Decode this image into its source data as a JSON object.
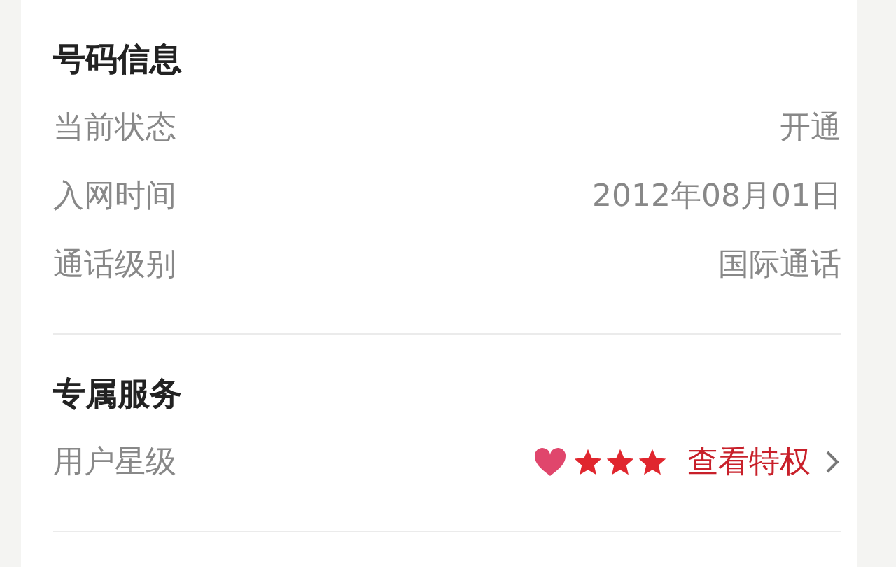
{
  "sections": [
    {
      "title": "号码信息",
      "rows": [
        {
          "kind": "text",
          "label": "当前状态",
          "value": "开通"
        },
        {
          "kind": "text",
          "label": "入网时间",
          "value": "2012年08月01日"
        },
        {
          "kind": "text",
          "label": "通话级别",
          "value": "国际通话"
        }
      ]
    },
    {
      "title": "专属服务",
      "rows": [
        {
          "kind": "stars",
          "label": "用户星级",
          "stars": 3,
          "link": "查看特权"
        }
      ]
    }
  ]
}
